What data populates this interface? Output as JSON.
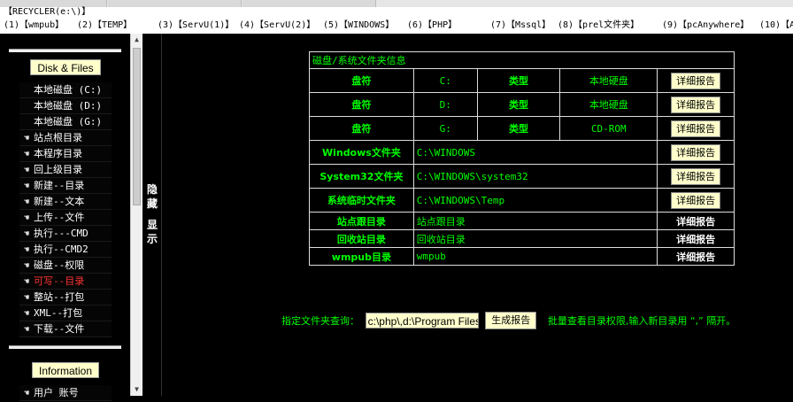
{
  "path_bar": "【RECYCLER(e:\\)】",
  "nav": [
    "(1)【wmpub】",
    "(2)【TEMP】",
    "(3)【ServU(1)】",
    "(4)【ServU(2)】",
    "(5)【WINDOWS】",
    "(6)【PHP】",
    "(7)【Mssql】",
    "(8)【prel文件夹】",
    "(9)【pcAnywhere】",
    "(10)【A"
  ],
  "sidebar": {
    "disk_title": "Disk & Files",
    "drives": [
      "本地磁盘 (C:)",
      "本地磁盘 (D:)",
      "本地磁盘 (G:)"
    ],
    "file_items": [
      "站点根目录",
      "本程序目录",
      "回上级目录",
      "新建--目录",
      "新建--文本",
      "上传--文件",
      "执行---CMD",
      "执行--CMD2",
      "磁盘--权限",
      "可写--目录",
      "整站--打包",
      "XML--打包",
      "下载--文件"
    ],
    "info_title": "Information",
    "info_items": [
      "用户  账号"
    ]
  },
  "toggle": {
    "hide": "隐藏",
    "show": "显示"
  },
  "table": {
    "header": "磁盘/系统文件夹信息",
    "drives": [
      {
        "label": "盘符",
        "letter": "C:",
        "type_label": "类型",
        "type": "本地硬盘",
        "button": "详细报告"
      },
      {
        "label": "盘符",
        "letter": "D:",
        "type_label": "类型",
        "type": "本地硬盘",
        "button": "详细报告"
      },
      {
        "label": "盘符",
        "letter": "G:",
        "type_label": "类型",
        "type": "CD-ROM",
        "button": "详细报告"
      }
    ],
    "folders": [
      {
        "label": "Windows文件夹",
        "path": "C:\\WINDOWS",
        "button": "详细报告"
      },
      {
        "label": "System32文件夹",
        "path": "C:\\WINDOWS\\system32",
        "button": "详细报告"
      },
      {
        "label": "系统临时文件夹",
        "path": "C:\\WINDOWS\\Temp",
        "button": "详细报告"
      }
    ],
    "links": [
      {
        "label": "站点跟目录",
        "path": "站点跟目录",
        "report": "详细报告"
      },
      {
        "label": "回收站目录",
        "path": "回收站目录",
        "report": "详细报告"
      },
      {
        "label": "wmpub目录",
        "path": "wmpub",
        "report": "详细报告"
      }
    ]
  },
  "query": {
    "label": "指定文件夹查询：",
    "value": "c:\\php\\,d:\\Program Files",
    "button": "生成报告",
    "hint": "批量查看目录权限,输入新目录用 “,” 隔开。"
  },
  "colors": {
    "accent_green": "#00ff00",
    "button_bg": "#ffffcc",
    "highlight_red": "#ff3333"
  }
}
